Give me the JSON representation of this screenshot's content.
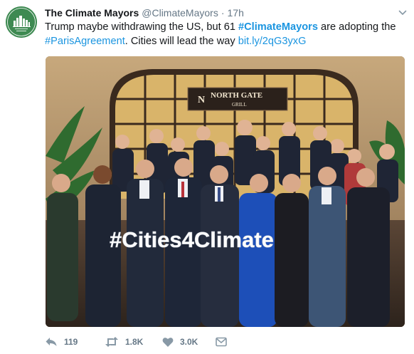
{
  "tweet": {
    "display_name": "The Climate Mayors",
    "handle": "@ClimateMayors",
    "separator": "·",
    "time": "17h",
    "text_part1": "Trump maybe withdrawing the US, but 61 ",
    "hashtag1": "#ClimateMayors",
    "text_part2": " are adopting the ",
    "hashtag2": "#ParisAgreement",
    "text_part3": ". Cities will lead the way ",
    "link": "bit.ly/2qG3yxG"
  },
  "avatar": {
    "label_top": "NATIONAL MAYORS",
    "label_bottom": "CLIMATE ACTION AGENDA"
  },
  "media": {
    "restaurant_sign": "NORTH GATE",
    "restaurant_sub": "GRILL",
    "held_sign": "#Cities4Climate"
  },
  "actions": {
    "reply_count": "119",
    "retweet_count": "1.8K",
    "like_count": "3.0K"
  },
  "colors": {
    "link": "#1b95e0",
    "muted": "#657786",
    "avatar_bg": "#3e8a52"
  }
}
